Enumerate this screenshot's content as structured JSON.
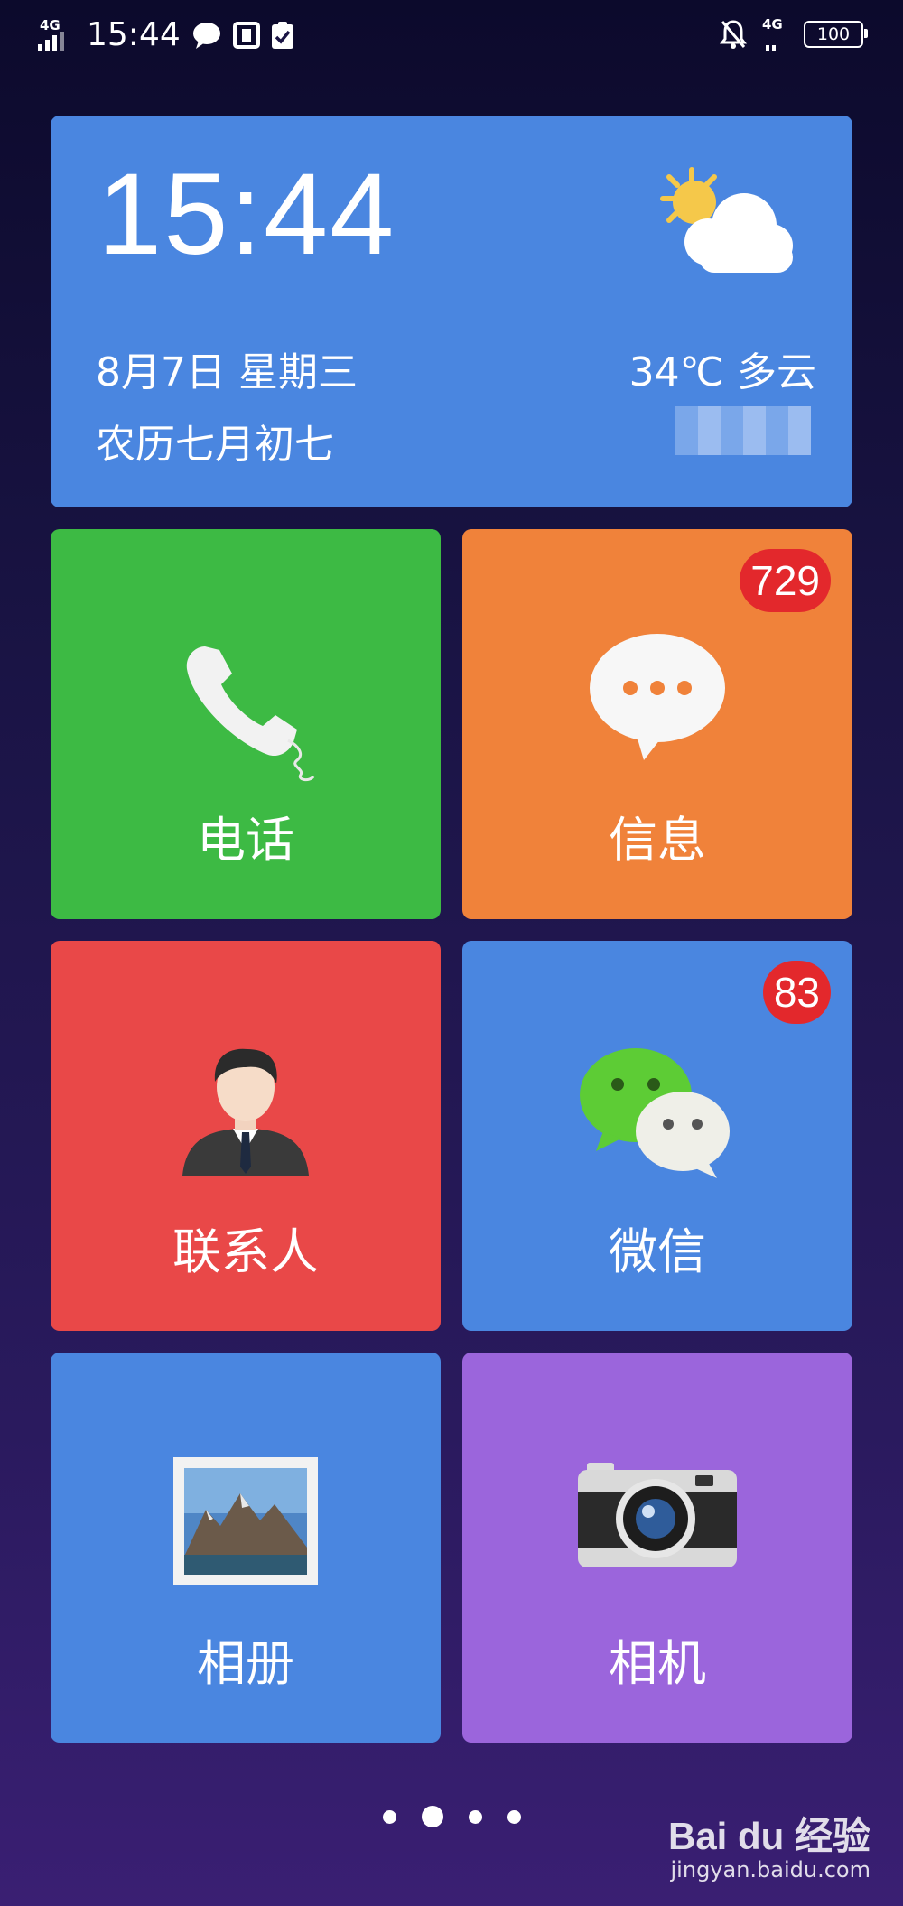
{
  "status_bar": {
    "time": "15:44",
    "left_network": "4G",
    "right_network": "4G",
    "battery": "100"
  },
  "clock_widget": {
    "time": "15:44",
    "date": "8月7日  星期三",
    "lunar_date": "农历七月初七",
    "weather": "34℃ 多云",
    "weather_icon": "partly-cloudy-icon"
  },
  "tiles": {
    "phone": {
      "label": "电话",
      "color": "#3dba44",
      "icon": "phone-handset-icon"
    },
    "messages": {
      "label": "信息",
      "color": "#f0823a",
      "badge": "729",
      "icon": "chat-bubble-icon"
    },
    "contacts": {
      "label": "联系人",
      "color": "#e94848",
      "icon": "person-avatar-icon"
    },
    "wechat": {
      "label": "微信",
      "color": "#4a86e0",
      "badge": "83",
      "icon": "wechat-icon"
    },
    "gallery": {
      "label": "相册",
      "color": "#4a86e0",
      "icon": "photo-album-icon"
    },
    "camera": {
      "label": "相机",
      "color": "#9b65dc",
      "icon": "camera-icon"
    }
  },
  "page_indicator": {
    "pages": 4,
    "active": 2
  },
  "watermark": {
    "main": "Bai du 经验",
    "sub": "jingyan.baidu.com"
  }
}
